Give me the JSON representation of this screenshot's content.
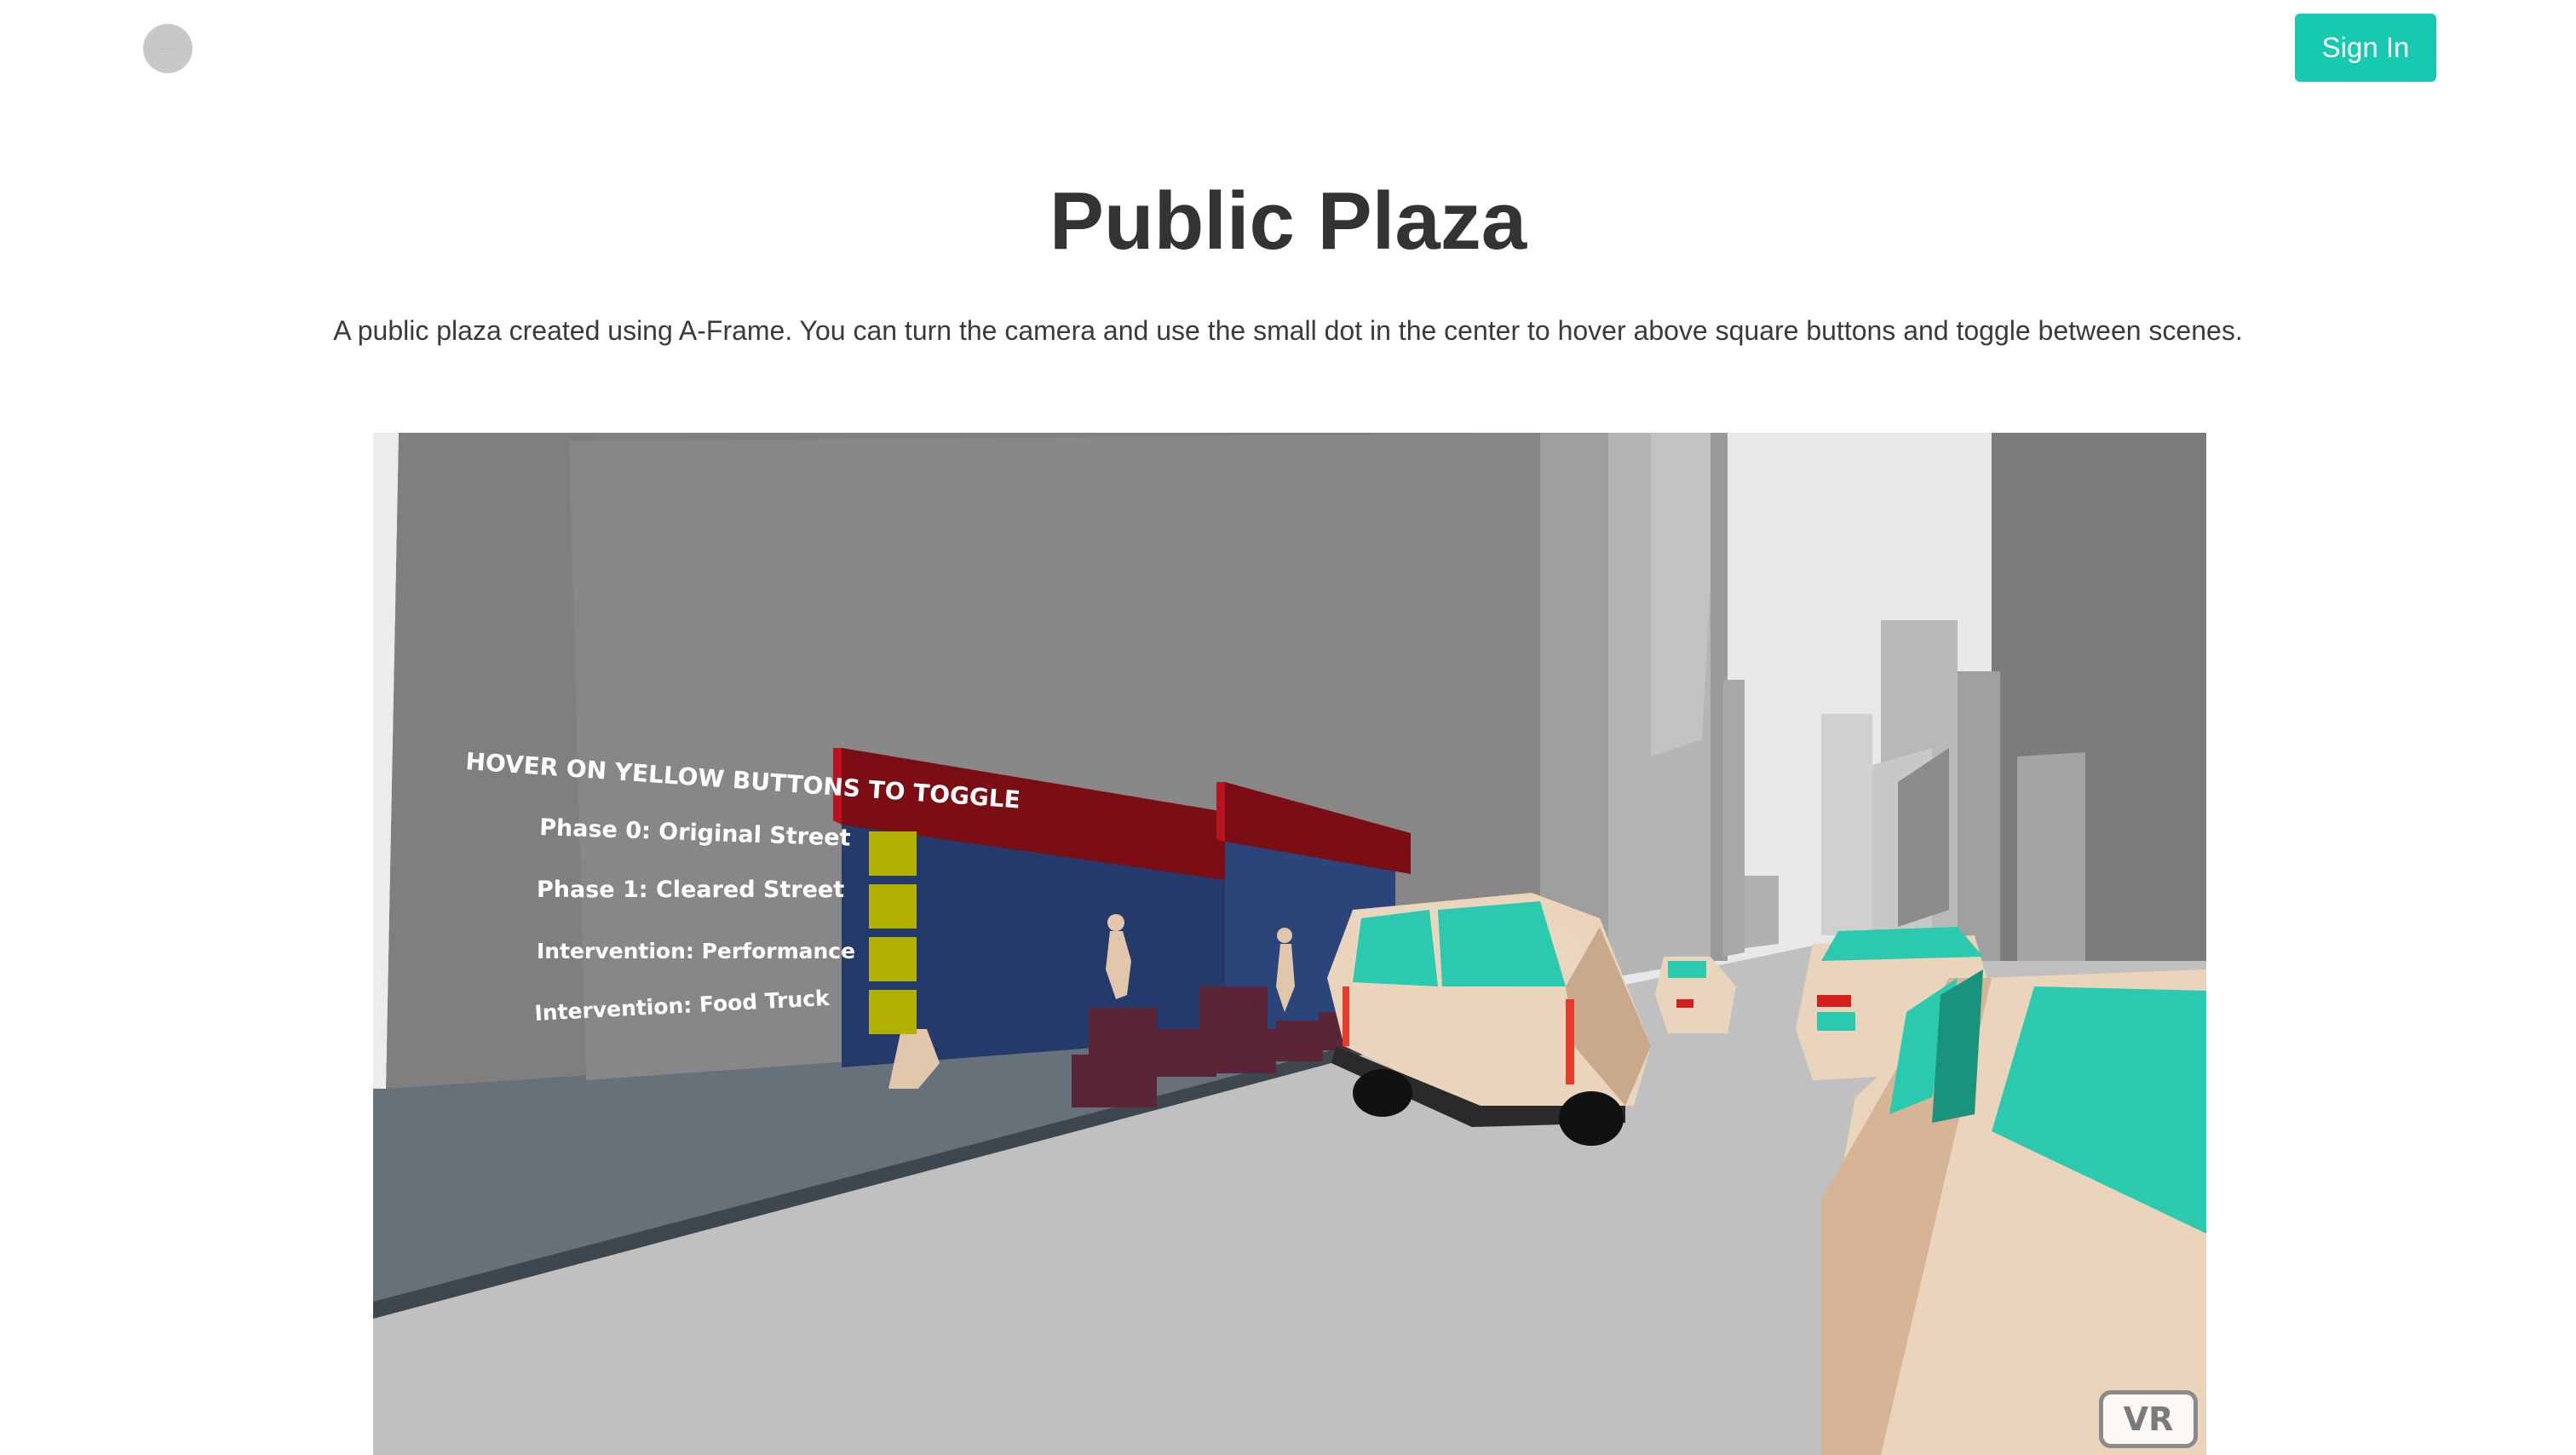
{
  "header": {
    "logo_icon": "avatar-placeholder-icon",
    "sign_in_label": "Sign In",
    "accent_color": "#17c9ae"
  },
  "page": {
    "title": "Public Plaza",
    "description": "A public plaza created using A-Frame. You can turn the camera and use the small dot in the center to hover above square buttons and toggle between scenes."
  },
  "scene": {
    "instruction": "HOVER ON YELLOW BUTTONS TO TOGGLE",
    "buttons": [
      {
        "label": "Phase 0: Original Street"
      },
      {
        "label": "Phase 1: Cleared Street"
      },
      {
        "label": "Intervention: Performance"
      },
      {
        "label": "Intervention: Food Truck"
      }
    ],
    "button_color": "#b0b000",
    "vr_label": "VR"
  }
}
